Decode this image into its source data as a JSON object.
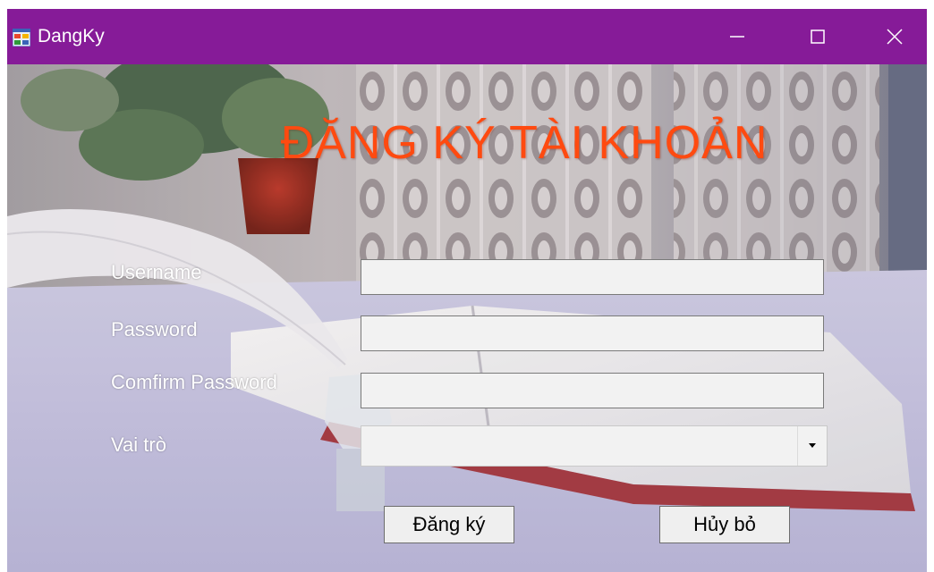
{
  "window": {
    "title": "DangKy",
    "titlebar_color": "#861b98"
  },
  "form": {
    "heading": "ĐĂNG KÝ TÀI KHOẢN",
    "heading_color": "#ff4a10",
    "username_label": "Username",
    "username_value": "",
    "password_label": "Password",
    "password_value": "",
    "confirm_label": "Comfirm Password",
    "confirm_value": "",
    "role_label": "Vai trò",
    "role_value": ""
  },
  "buttons": {
    "register_label": "Đăng ký",
    "cancel_label": "Hủy bỏ"
  },
  "icons": {
    "app": "app-form-icon",
    "minimize": "minimize-icon",
    "maximize": "maximize-icon",
    "close": "close-icon",
    "dropdown": "dropdown-arrow-icon"
  }
}
